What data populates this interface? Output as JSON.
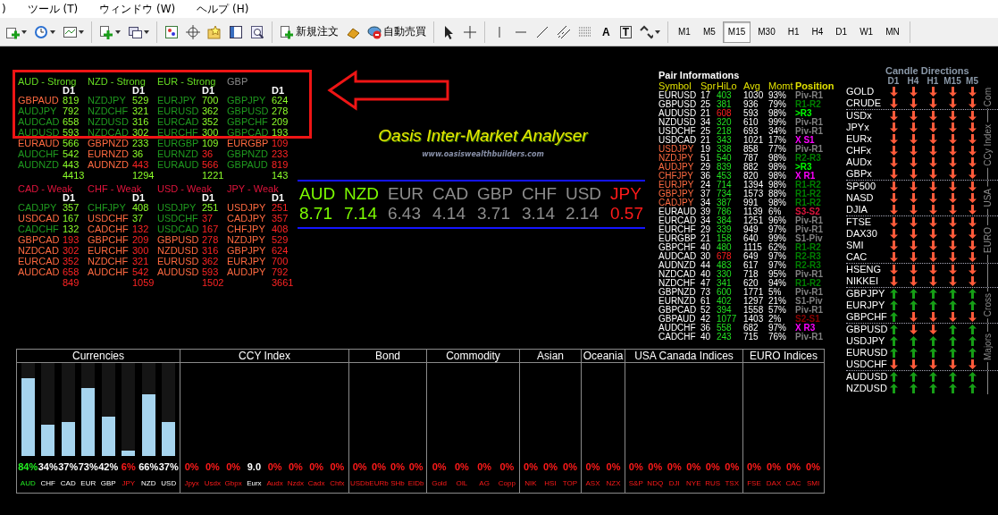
{
  "menu": [
    ")",
    "ツール (T)",
    "ウィンドウ (W)",
    "ヘルプ (H)"
  ],
  "toolbar": {
    "new_order": "新規注文",
    "auto_trading": "自動売買",
    "text_tool": "A",
    "text_label_tool": "T",
    "timeframes": [
      {
        "label": "M1",
        "selected": false
      },
      {
        "label": "M5",
        "selected": false
      },
      {
        "label": "M15",
        "selected": true
      },
      {
        "label": "M30",
        "selected": false
      },
      {
        "label": "H1",
        "selected": false
      },
      {
        "label": "H4",
        "selected": false
      },
      {
        "label": "D1",
        "selected": false
      },
      {
        "label": "W1",
        "selected": false
      },
      {
        "label": "MN",
        "selected": false
      }
    ]
  },
  "strength_tables": [
    {
      "header": "AUD - Strong",
      "color": "#66dd22",
      "column_label": "D1",
      "total": "4413",
      "total_negative": false,
      "rows": [
        {
          "symbol": "GBPAUD",
          "inverted": true,
          "value": "819",
          "negative": false
        },
        {
          "symbol": "AUDJPY",
          "inverted": false,
          "value": "792",
          "negative": false
        },
        {
          "symbol": "AUDCAD",
          "inverted": false,
          "value": "658",
          "negative": false
        },
        {
          "symbol": "AUDUSD",
          "inverted": false,
          "value": "593",
          "negative": false
        },
        {
          "symbol": "EURAUD",
          "inverted": true,
          "value": "566",
          "negative": false
        },
        {
          "symbol": "AUDCHF",
          "inverted": false,
          "value": "542",
          "negative": false
        },
        {
          "symbol": "AUDNZD",
          "inverted": false,
          "value": "443",
          "negative": false
        }
      ]
    },
    {
      "header": "NZD - Strong",
      "color": "#66dd22",
      "column_label": "D1",
      "total": "1294",
      "total_negative": false,
      "rows": [
        {
          "symbol": "NZDJPY",
          "inverted": false,
          "value": "529",
          "negative": false
        },
        {
          "symbol": "NZDCHF",
          "inverted": false,
          "value": "321",
          "negative": false
        },
        {
          "symbol": "NZDUSD",
          "inverted": false,
          "value": "316",
          "negative": false
        },
        {
          "symbol": "NZDCAD",
          "inverted": false,
          "value": "302",
          "negative": false
        },
        {
          "symbol": "GBPNZD",
          "inverted": true,
          "value": "233",
          "negative": false
        },
        {
          "symbol": "EURNZD",
          "inverted": true,
          "value": "36",
          "negative": false
        },
        {
          "symbol": "AUDNZD",
          "inverted": true,
          "value": "443",
          "negative": true
        }
      ]
    },
    {
      "header": "EUR - Strong",
      "color": "#66dd22",
      "column_label": "D1",
      "total": "1221",
      "total_negative": false,
      "rows": [
        {
          "symbol": "EURJPY",
          "inverted": false,
          "value": "700",
          "negative": false
        },
        {
          "symbol": "EURUSD",
          "inverted": false,
          "value": "362",
          "negative": false
        },
        {
          "symbol": "EURCAD",
          "inverted": false,
          "value": "352",
          "negative": false
        },
        {
          "symbol": "EURCHF",
          "inverted": false,
          "value": "300",
          "negative": false
        },
        {
          "symbol": "EURGBP",
          "inverted": false,
          "value": "109",
          "negative": false
        },
        {
          "symbol": "EURNZD",
          "inverted": false,
          "value": "36",
          "negative": true
        },
        {
          "symbol": "EURAUD",
          "inverted": false,
          "value": "566",
          "negative": true
        }
      ]
    },
    {
      "header": "GBP",
      "color": "#8a8a8a",
      "column_label": "D1",
      "total": "143",
      "total_negative": false,
      "rows": [
        {
          "symbol": "GBPJPY",
          "inverted": false,
          "value": "624",
          "negative": false
        },
        {
          "symbol": "GBPUSD",
          "inverted": false,
          "value": "278",
          "negative": false
        },
        {
          "symbol": "GBPCHF",
          "inverted": false,
          "value": "209",
          "negative": false
        },
        {
          "symbol": "GBPCAD",
          "inverted": false,
          "value": "193",
          "negative": false
        },
        {
          "symbol": "EURGBP",
          "inverted": true,
          "value": "109",
          "negative": true
        },
        {
          "symbol": "GBPNZD",
          "inverted": false,
          "value": "233",
          "negative": true
        },
        {
          "symbol": "GBPAUD",
          "inverted": false,
          "value": "819",
          "negative": true
        }
      ]
    },
    {
      "header": "CAD - Weak",
      "color": "#e0143c",
      "column_label": "D1",
      "total": "849",
      "total_negative": true,
      "rows": [
        {
          "symbol": "CADJPY",
          "inverted": false,
          "value": "357",
          "negative": false
        },
        {
          "symbol": "USDCAD",
          "inverted": true,
          "value": "167",
          "negative": false
        },
        {
          "symbol": "CADCHF",
          "inverted": false,
          "value": "132",
          "negative": false
        },
        {
          "symbol": "GBPCAD",
          "inverted": true,
          "value": "193",
          "negative": true
        },
        {
          "symbol": "NZDCAD",
          "inverted": true,
          "value": "302",
          "negative": true
        },
        {
          "symbol": "EURCAD",
          "inverted": true,
          "value": "352",
          "negative": true
        },
        {
          "symbol": "AUDCAD",
          "inverted": true,
          "value": "658",
          "negative": true
        }
      ]
    },
    {
      "header": "CHF - Weak",
      "color": "#e0143c",
      "column_label": "D1",
      "total": "1059",
      "total_negative": true,
      "rows": [
        {
          "symbol": "CHFJPY",
          "inverted": false,
          "value": "408",
          "negative": false
        },
        {
          "symbol": "USDCHF",
          "inverted": true,
          "value": "37",
          "negative": false
        },
        {
          "symbol": "CADCHF",
          "inverted": true,
          "value": "132",
          "negative": true
        },
        {
          "symbol": "GBPCHF",
          "inverted": true,
          "value": "209",
          "negative": true
        },
        {
          "symbol": "EURCHF",
          "inverted": true,
          "value": "300",
          "negative": true
        },
        {
          "symbol": "NZDCHF",
          "inverted": true,
          "value": "321",
          "negative": true
        },
        {
          "symbol": "AUDCHF",
          "inverted": true,
          "value": "542",
          "negative": true
        }
      ]
    },
    {
      "header": "USD - Weak",
      "color": "#e0143c",
      "column_label": "D1",
      "total": "1502",
      "total_negative": true,
      "rows": [
        {
          "symbol": "USDJPY",
          "inverted": false,
          "value": "251",
          "negative": false
        },
        {
          "symbol": "USDCHF",
          "inverted": false,
          "value": "37",
          "negative": true
        },
        {
          "symbol": "USDCAD",
          "inverted": false,
          "value": "167",
          "negative": true
        },
        {
          "symbol": "GBPUSD",
          "inverted": true,
          "value": "278",
          "negative": true
        },
        {
          "symbol": "NZDUSD",
          "inverted": true,
          "value": "316",
          "negative": true
        },
        {
          "symbol": "EURUSD",
          "inverted": true,
          "value": "362",
          "negative": true
        },
        {
          "symbol": "AUDUSD",
          "inverted": true,
          "value": "593",
          "negative": true
        }
      ]
    },
    {
      "header": "JPY - Weak",
      "color": "#e0143c",
      "column_label": "D1",
      "total": "3661",
      "total_negative": true,
      "rows": [
        {
          "symbol": "USDJPY",
          "inverted": true,
          "value": "251",
          "negative": true
        },
        {
          "symbol": "CADJPY",
          "inverted": true,
          "value": "357",
          "negative": true
        },
        {
          "symbol": "CHFJPY",
          "inverted": true,
          "value": "408",
          "negative": true
        },
        {
          "symbol": "NZDJPY",
          "inverted": true,
          "value": "529",
          "negative": true
        },
        {
          "symbol": "GBPJPY",
          "inverted": true,
          "value": "624",
          "negative": true
        },
        {
          "symbol": "EURJPY",
          "inverted": true,
          "value": "700",
          "negative": true
        },
        {
          "symbol": "AUDJPY",
          "inverted": true,
          "value": "792",
          "negative": true
        }
      ]
    }
  ],
  "title": "Oasis Inter-Market Analyser",
  "website": "www.oasiswealthbuilders.com",
  "strength_strip": [
    {
      "currency": "AUD",
      "score": "8.71",
      "color": "#7cfc00"
    },
    {
      "currency": "NZD",
      "score": "7.14",
      "color": "#7cfc00"
    },
    {
      "currency": "EUR",
      "score": "6.43",
      "color": "#8c8c8c"
    },
    {
      "currency": "CAD",
      "score": "4.14",
      "color": "#8c8c8c"
    },
    {
      "currency": "GBP",
      "score": "3.71",
      "color": "#8c8c8c"
    },
    {
      "currency": "CHF",
      "score": "3.14",
      "color": "#8c8c8c"
    },
    {
      "currency": "USD",
      "score": "2.14",
      "color": "#8c8c8c"
    },
    {
      "currency": "JPY",
      "score": "0.57",
      "color": "#ff1a1a"
    }
  ],
  "pair_info": {
    "title": "Pair Informations",
    "columns": [
      "Symbol",
      "Spr",
      "HiLo",
      "Avg",
      "Momt",
      "Position"
    ],
    "rows": [
      {
        "symbol": "EURUSD",
        "cross": false,
        "spread": "17",
        "hilo": "403",
        "hilo_high": false,
        "avg": "1030",
        "momentum": "93%",
        "position": "Piv-R1",
        "color": "#808080"
      },
      {
        "symbol": "GBPUSD",
        "cross": false,
        "spread": "25",
        "hilo": "381",
        "hilo_high": false,
        "avg": "936",
        "momentum": "79%",
        "position": "R1-R2",
        "color": "#008000"
      },
      {
        "symbol": "AUDUSD",
        "cross": false,
        "spread": "21",
        "hilo": "608",
        "hilo_high": true,
        "avg": "593",
        "momentum": "98%",
        "position": ">R3",
        "color": "#00ff00"
      },
      {
        "symbol": "NZDUSD",
        "cross": false,
        "spread": "34",
        "hilo": "320",
        "hilo_high": false,
        "avg": "610",
        "momentum": "99%",
        "position": "Piv-R1",
        "color": "#808080"
      },
      {
        "symbol": "USDCHF",
        "cross": false,
        "spread": "25",
        "hilo": "218",
        "hilo_high": false,
        "avg": "693",
        "momentum": "34%",
        "position": "Piv-R1",
        "color": "#808080"
      },
      {
        "symbol": "USDCAD",
        "cross": false,
        "spread": "21",
        "hilo": "343",
        "hilo_high": false,
        "avg": "1021",
        "momentum": "17%",
        "position": "X S1",
        "color": "#ff00ff"
      },
      {
        "symbol": "USDJPY",
        "cross": true,
        "spread": "19",
        "hilo": "338",
        "hilo_high": false,
        "avg": "858",
        "momentum": "77%",
        "position": "Piv-R1",
        "color": "#808080"
      },
      {
        "symbol": "NZDJPY",
        "cross": true,
        "spread": "51",
        "hilo": "540",
        "hilo_high": false,
        "avg": "787",
        "momentum": "98%",
        "position": "R2-R3",
        "color": "#008000"
      },
      {
        "symbol": "AUDJPY",
        "cross": true,
        "spread": "29",
        "hilo": "839",
        "hilo_high": false,
        "avg": "882",
        "momentum": "98%",
        "position": ">R3",
        "color": "#00ff00"
      },
      {
        "symbol": "CHFJPY",
        "cross": true,
        "spread": "36",
        "hilo": "453",
        "hilo_high": false,
        "avg": "820",
        "momentum": "98%",
        "position": "X R1",
        "color": "#ff00ff"
      },
      {
        "symbol": "EURJPY",
        "cross": true,
        "spread": "24",
        "hilo": "714",
        "hilo_high": false,
        "avg": "1394",
        "momentum": "98%",
        "position": "R1-R2",
        "color": "#008000"
      },
      {
        "symbol": "GBPJPY",
        "cross": true,
        "spread": "37",
        "hilo": "734",
        "hilo_high": false,
        "avg": "1573",
        "momentum": "88%",
        "position": "R1-R2",
        "color": "#008000"
      },
      {
        "symbol": "CADJPY",
        "cross": true,
        "spread": "34",
        "hilo": "387",
        "hilo_high": false,
        "avg": "991",
        "momentum": "98%",
        "position": "R1-R2",
        "color": "#008000"
      },
      {
        "symbol": "EURAUD",
        "cross": false,
        "spread": "39",
        "hilo": "786",
        "hilo_high": false,
        "avg": "1139",
        "momentum": "6%",
        "position": "S3-S2",
        "color": "#dc143c"
      },
      {
        "symbol": "EURCAD",
        "cross": false,
        "spread": "34",
        "hilo": "384",
        "hilo_high": false,
        "avg": "1251",
        "momentum": "96%",
        "position": "Piv-R1",
        "color": "#808080"
      },
      {
        "symbol": "EURCHF",
        "cross": false,
        "spread": "29",
        "hilo": "339",
        "hilo_high": false,
        "avg": "949",
        "momentum": "97%",
        "position": "Piv-R1",
        "color": "#808080"
      },
      {
        "symbol": "EURGBP",
        "cross": false,
        "spread": "21",
        "hilo": "158",
        "hilo_high": false,
        "avg": "640",
        "momentum": "99%",
        "position": "S1-Piv",
        "color": "#808080"
      },
      {
        "symbol": "GBPCHF",
        "cross": false,
        "spread": "40",
        "hilo": "480",
        "hilo_high": false,
        "avg": "1115",
        "momentum": "62%",
        "position": "R1-R2",
        "color": "#008000"
      },
      {
        "symbol": "AUDCAD",
        "cross": false,
        "spread": "30",
        "hilo": "678",
        "hilo_high": true,
        "avg": "649",
        "momentum": "97%",
        "position": "R2-R3",
        "color": "#008000"
      },
      {
        "symbol": "AUDNZD",
        "cross": false,
        "spread": "44",
        "hilo": "483",
        "hilo_high": false,
        "avg": "617",
        "momentum": "97%",
        "position": "R2-R3",
        "color": "#008000"
      },
      {
        "symbol": "NZDCAD",
        "cross": false,
        "spread": "40",
        "hilo": "330",
        "hilo_high": false,
        "avg": "718",
        "momentum": "95%",
        "position": "Piv-R1",
        "color": "#808080"
      },
      {
        "symbol": "NZDCHF",
        "cross": false,
        "spread": "47",
        "hilo": "341",
        "hilo_high": false,
        "avg": "620",
        "momentum": "94%",
        "position": "R1-R2",
        "color": "#008000"
      },
      {
        "symbol": "GBPNZD",
        "cross": false,
        "spread": "73",
        "hilo": "600",
        "hilo_high": false,
        "avg": "1771",
        "momentum": "5%",
        "position": "Piv-R1",
        "color": "#808080"
      },
      {
        "symbol": "EURNZD",
        "cross": false,
        "spread": "61",
        "hilo": "402",
        "hilo_high": false,
        "avg": "1297",
        "momentum": "21%",
        "position": "S1-Piv",
        "color": "#808080"
      },
      {
        "symbol": "GBPCAD",
        "cross": false,
        "spread": "52",
        "hilo": "394",
        "hilo_high": false,
        "avg": "1558",
        "momentum": "57%",
        "position": "Piv-R1",
        "color": "#808080"
      },
      {
        "symbol": "GBPAUD",
        "cross": false,
        "spread": "42",
        "hilo": "1077",
        "hilo_high": false,
        "avg": "1403",
        "momentum": "2%",
        "position": "S2-S1",
        "color": "#8b0000"
      },
      {
        "symbol": "AUDCHF",
        "cross": false,
        "spread": "36",
        "hilo": "558",
        "hilo_high": false,
        "avg": "682",
        "momentum": "97%",
        "position": "X R3",
        "color": "#ff00ff"
      },
      {
        "symbol": "CADCHF",
        "cross": false,
        "spread": "40",
        "hilo": "243",
        "hilo_high": false,
        "avg": "715",
        "momentum": "76%",
        "position": "Piv-R1",
        "color": "#808080"
      }
    ]
  },
  "candle_directions": {
    "title": "Candle Directions",
    "timeframes": [
      "D1",
      "H4",
      "H1",
      "M15",
      "M5"
    ],
    "groups": [
      {
        "label": "Com",
        "rows": [
          {
            "instrument": "GOLD",
            "rising": [
              false,
              false,
              false,
              false,
              false
            ]
          },
          {
            "instrument": "CRUDE",
            "rising": [
              false,
              false,
              false,
              false,
              false
            ]
          }
        ]
      },
      {
        "label": "CCy Index",
        "rows": [
          {
            "instrument": "USDx",
            "rising": [
              false,
              false,
              false,
              false,
              false
            ]
          },
          {
            "instrument": "JPYx",
            "rising": [
              false,
              false,
              false,
              false,
              false
            ]
          },
          {
            "instrument": "EURx",
            "rising": [
              false,
              false,
              false,
              false,
              false
            ]
          },
          {
            "instrument": "CHFx",
            "rising": [
              false,
              false,
              false,
              false,
              false
            ]
          },
          {
            "instrument": "AUDx",
            "rising": [
              false,
              false,
              false,
              false,
              false
            ]
          },
          {
            "instrument": "GBPx",
            "rising": [
              false,
              false,
              false,
              false,
              false
            ]
          }
        ]
      },
      {
        "label": "USA",
        "rows": [
          {
            "instrument": "SP500",
            "rising": [
              false,
              false,
              false,
              false,
              false
            ]
          },
          {
            "instrument": "NASD",
            "rising": [
              false,
              false,
              false,
              false,
              false
            ]
          },
          {
            "instrument": "DJIA",
            "rising": [
              false,
              false,
              false,
              false,
              false
            ]
          }
        ]
      },
      {
        "label": "EURO",
        "rows": [
          {
            "instrument": "FTSE",
            "rising": [
              false,
              false,
              false,
              false,
              false
            ]
          },
          {
            "instrument": "DAX30",
            "rising": [
              false,
              false,
              false,
              false,
              false
            ]
          },
          {
            "instrument": "SMI",
            "rising": [
              false,
              false,
              false,
              false,
              false
            ]
          },
          {
            "instrument": "CAC",
            "rising": [
              false,
              false,
              false,
              false,
              false
            ]
          }
        ]
      },
      {
        "rows": [
          {
            "instrument": "HSENG",
            "rising": [
              false,
              false,
              false,
              false,
              false
            ]
          },
          {
            "instrument": "NIKKEI",
            "rising": [
              false,
              false,
              false,
              false,
              false
            ]
          }
        ]
      },
      {
        "label": "Cross",
        "rows": [
          {
            "instrument": "GBPJPY",
            "rising": [
              true,
              true,
              true,
              true,
              true
            ]
          },
          {
            "instrument": "EURJPY",
            "rising": [
              true,
              true,
              true,
              true,
              true
            ]
          },
          {
            "instrument": "GBPCHF",
            "rising": [
              true,
              false,
              false,
              false,
              false
            ]
          }
        ]
      },
      {
        "label": "Majors",
        "rows": [
          {
            "instrument": "GBPUSD",
            "rising": [
              true,
              false,
              false,
              true,
              true
            ]
          },
          {
            "instrument": "USDJPY",
            "rising": [
              true,
              true,
              true,
              true,
              true
            ]
          },
          {
            "instrument": "EURUSD",
            "rising": [
              true,
              true,
              true,
              true,
              true
            ]
          },
          {
            "instrument": "USDCHF",
            "rising": [
              false,
              false,
              false,
              false,
              false
            ]
          }
        ]
      },
      {
        "rows": [
          {
            "instrument": "AUDUSD",
            "rising": [
              true,
              true,
              true,
              true,
              true
            ]
          },
          {
            "instrument": "NZDUSD",
            "rising": [
              true,
              true,
              true,
              true,
              true
            ]
          }
        ]
      }
    ]
  },
  "panels": [
    {
      "title": "Currencies",
      "kind": "bars",
      "items": [
        {
          "value": "84%",
          "label": "AUD",
          "color": "#22ee22",
          "level": 0.84
        },
        {
          "value": "34%",
          "label": "CHF",
          "color": "#ffffff",
          "level": 0.34
        },
        {
          "value": "37%",
          "label": "CAD",
          "color": "#ffffff",
          "level": 0.37
        },
        {
          "value": "73%",
          "label": "EUR",
          "color": "#ffffff",
          "level": 0.73
        },
        {
          "value": "42%",
          "label": "GBP",
          "color": "#ffffff",
          "level": 0.42
        },
        {
          "value": "6%",
          "label": "JPY",
          "color": "#ff1a1a",
          "level": 0.06
        },
        {
          "value": "66%",
          "label": "NZD",
          "color": "#ffffff",
          "level": 0.66
        },
        {
          "value": "37%",
          "label": "USD",
          "color": "#ffffff",
          "level": 0.37
        }
      ]
    },
    {
      "title": "CCY Index",
      "kind": "values",
      "items": [
        {
          "value": "0%",
          "label": "Jpyx",
          "color": "#ff1a1a"
        },
        {
          "value": "0%",
          "label": "Usdx",
          "color": "#ff1a1a"
        },
        {
          "value": "0%",
          "label": "Gbpx",
          "color": "#ff1a1a"
        },
        {
          "value": "9.0",
          "label": "Eurx",
          "color": "#ffffff"
        },
        {
          "value": "0%",
          "label": "Audx",
          "color": "#ff1a1a"
        },
        {
          "value": "0%",
          "label": "Nzdx",
          "color": "#ff1a1a"
        },
        {
          "value": "0%",
          "label": "Cadx",
          "color": "#ff1a1a"
        },
        {
          "value": "0%",
          "label": "Chfx",
          "color": "#ff1a1a"
        }
      ]
    },
    {
      "title": "Bond",
      "kind": "values",
      "items": [
        {
          "value": "0%",
          "label": "USDb",
          "color": "#ff1a1a"
        },
        {
          "value": "0%",
          "label": "EURb",
          "color": "#ff1a1a"
        },
        {
          "value": "0%",
          "label": "SHb",
          "color": "#ff1a1a"
        },
        {
          "value": "0%",
          "label": "EIDb",
          "color": "#ff1a1a"
        }
      ]
    },
    {
      "title": "Commodity",
      "kind": "values",
      "items": [
        {
          "value": "0%",
          "label": "Gold",
          "color": "#ff1a1a"
        },
        {
          "value": "0%",
          "label": "OIL",
          "color": "#ff1a1a"
        },
        {
          "value": "0%",
          "label": "AG",
          "color": "#ff1a1a"
        },
        {
          "value": "0%",
          "label": "Copp",
          "color": "#ff1a1a"
        }
      ]
    },
    {
      "title": "Asian",
      "kind": "values",
      "items": [
        {
          "value": "0%",
          "label": "NIK",
          "color": "#ff1a1a"
        },
        {
          "value": "0%",
          "label": "HSI",
          "color": "#ff1a1a"
        },
        {
          "value": "0%",
          "label": "TOP",
          "color": "#ff1a1a"
        }
      ]
    },
    {
      "title": "Oceania",
      "kind": "values",
      "items": [
        {
          "value": "0%",
          "label": "ASX",
          "color": "#ff1a1a"
        },
        {
          "value": "0%",
          "label": "NZX",
          "color": "#ff1a1a"
        }
      ]
    },
    {
      "title": "USA Canada Indices",
      "kind": "values",
      "items": [
        {
          "value": "0%",
          "label": "S&P",
          "color": "#ff1a1a"
        },
        {
          "value": "0%",
          "label": "NDQ",
          "color": "#ff1a1a"
        },
        {
          "value": "0%",
          "label": "DJI",
          "color": "#ff1a1a"
        },
        {
          "value": "0%",
          "label": "NYE",
          "color": "#ff1a1a"
        },
        {
          "value": "0%",
          "label": "RUS",
          "color": "#ff1a1a"
        },
        {
          "value": "0%",
          "label": "TSX",
          "color": "#ff1a1a"
        }
      ]
    },
    {
      "title": "EURO Indices",
      "kind": "values",
      "items": [
        {
          "value": "0%",
          "label": "FSE",
          "color": "#ff1a1a"
        },
        {
          "value": "0%",
          "label": "DAX",
          "color": "#ff1a1a"
        },
        {
          "value": "0%",
          "label": "CAC",
          "color": "#ff1a1a"
        },
        {
          "value": "0%",
          "label": "SMI",
          "color": "#ff1a1a"
        }
      ]
    }
  ]
}
